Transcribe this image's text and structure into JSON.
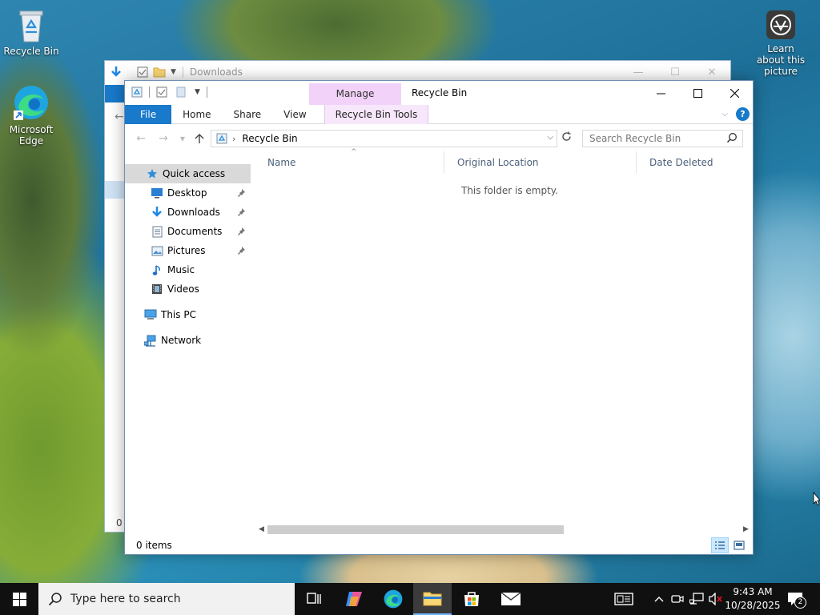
{
  "desktop": {
    "icons": [
      {
        "label": "Recycle Bin",
        "icon": "recycle-bin-icon"
      },
      {
        "label": "Microsoft Edge",
        "icon": "edge-icon"
      },
      {
        "label": "Learn about this picture",
        "icon": "camera-icon"
      }
    ]
  },
  "background_window": {
    "title": "Downloads",
    "footer": "0 i"
  },
  "window": {
    "title": "Recycle Bin",
    "context_tab": "Manage",
    "ribbon_tabs": [
      "File",
      "Home",
      "Share",
      "View",
      "Recycle Bin Tools"
    ],
    "address": {
      "path": "Recycle Bin"
    },
    "search": {
      "placeholder": "Search Recycle Bin"
    },
    "nav": {
      "quick_access": "Quick access",
      "items": [
        {
          "label": "Desktop",
          "pinned": true
        },
        {
          "label": "Downloads",
          "pinned": true
        },
        {
          "label": "Documents",
          "pinned": true
        },
        {
          "label": "Pictures",
          "pinned": true
        },
        {
          "label": "Music",
          "pinned": false
        },
        {
          "label": "Videos",
          "pinned": false
        }
      ],
      "this_pc": "This PC",
      "network": "Network"
    },
    "columns": [
      "Name",
      "Original Location",
      "Date Deleted"
    ],
    "empty_message": "This folder is empty.",
    "status": "0 items"
  },
  "taskbar": {
    "search_placeholder": "Type here to search",
    "time": "9:43 AM",
    "date": "10/28/2025",
    "notification_count": "2"
  },
  "colors": {
    "accent": "#1979ca",
    "manage_tab": "#f2d2f9",
    "taskbar": "#101010"
  }
}
